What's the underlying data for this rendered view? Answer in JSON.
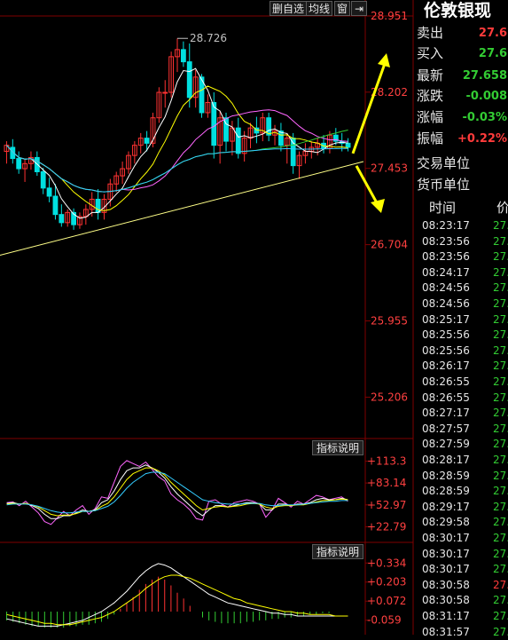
{
  "toolbar": {
    "del_fav": "删自选",
    "ma": "均线",
    "window": "窗"
  },
  "colors": {
    "up": "#ff3232",
    "down": "#00e0e0",
    "ma5": "#ffffff",
    "ma10": "#ffff00",
    "ma20": "#ff66ff",
    "ma60": "#33cc33",
    "ma120": "#33ccff",
    "trend": "#ffff88",
    "arrow": "#ffff00",
    "grid": "#800000",
    "axis_text": "#ff4040"
  },
  "instrument": {
    "title": "伦敦银现",
    "rows": [
      {
        "label": "卖出",
        "value": "27.6",
        "color": "#ff3b3b"
      },
      {
        "label": "买入",
        "value": "27.6",
        "color": "#33cc33"
      },
      {
        "label": "最新",
        "value": "27.658",
        "color": "#33cc33"
      },
      {
        "label": "涨跌",
        "value": "-0.008",
        "color": "#33cc33"
      },
      {
        "label": "涨幅",
        "value": "-0.03%",
        "color": "#33cc33"
      },
      {
        "label": "振幅",
        "value": "+0.22%",
        "color": "#ff3b3b"
      },
      {
        "label": "交易单位",
        "value": "",
        "color": "#e6e6e6"
      },
      {
        "label": "货币单位",
        "value": "",
        "color": "#e6e6e6"
      }
    ]
  },
  "ticks": {
    "header_time": "时间",
    "header_price": "价",
    "rows": [
      {
        "time": "08:23:17",
        "price": "27.",
        "dir": "down"
      },
      {
        "time": "08:23:56",
        "price": "27.",
        "dir": "down"
      },
      {
        "time": "08:23:56",
        "price": "27.",
        "dir": "down"
      },
      {
        "time": "08:24:17",
        "price": "27.",
        "dir": "down"
      },
      {
        "time": "08:24:56",
        "price": "27.",
        "dir": "down"
      },
      {
        "time": "08:24:56",
        "price": "27.",
        "dir": "down"
      },
      {
        "time": "08:25:17",
        "price": "27.",
        "dir": "down"
      },
      {
        "time": "08:25:56",
        "price": "27.",
        "dir": "down"
      },
      {
        "time": "08:25:56",
        "price": "27.",
        "dir": "down"
      },
      {
        "time": "08:26:17",
        "price": "27.",
        "dir": "down"
      },
      {
        "time": "08:26:55",
        "price": "27.",
        "dir": "down"
      },
      {
        "time": "08:26:55",
        "price": "27.",
        "dir": "down"
      },
      {
        "time": "08:27:17",
        "price": "27.",
        "dir": "down"
      },
      {
        "time": "08:27:57",
        "price": "27.",
        "dir": "down"
      },
      {
        "time": "08:27:59",
        "price": "27.",
        "dir": "down"
      },
      {
        "time": "08:28:17",
        "price": "27.",
        "dir": "down"
      },
      {
        "time": "08:28:59",
        "price": "27.",
        "dir": "down"
      },
      {
        "time": "08:28:59",
        "price": "27.",
        "dir": "down"
      },
      {
        "time": "08:29:17",
        "price": "27.",
        "dir": "down"
      },
      {
        "time": "08:29:58",
        "price": "27.",
        "dir": "down"
      },
      {
        "time": "08:30:17",
        "price": "27.",
        "dir": "down"
      },
      {
        "time": "08:30:17",
        "price": "27.",
        "dir": "down"
      },
      {
        "time": "08:30:17",
        "price": "27.",
        "dir": "down"
      },
      {
        "time": "08:30:58",
        "price": "27.",
        "dir": "up"
      },
      {
        "time": "08:30:58",
        "price": "27.",
        "dir": "down"
      },
      {
        "time": "08:31:17",
        "price": "27.",
        "dir": "down"
      },
      {
        "time": "08:31:57",
        "price": "27.",
        "dir": "down"
      }
    ]
  },
  "chart_data": [
    {
      "type": "candlestick",
      "ylim": [
        24.8,
        28.95
      ],
      "y_ticks": [
        28.951,
        28.202,
        27.453,
        26.704,
        25.955,
        25.206
      ],
      "y_tick_labels": [
        "28.951",
        "28.202",
        "27.453",
        "26.704",
        "25.955",
        "25.206"
      ],
      "annotation": "28.726",
      "candles": [
        [
          27.62,
          27.72,
          27.5,
          27.68
        ],
        [
          27.66,
          27.74,
          27.5,
          27.55
        ],
        [
          27.55,
          27.62,
          27.4,
          27.45
        ],
        [
          27.45,
          27.55,
          27.32,
          27.5
        ],
        [
          27.5,
          27.62,
          27.44,
          27.56
        ],
        [
          27.56,
          27.62,
          27.38,
          27.42
        ],
        [
          27.42,
          27.46,
          27.2,
          27.26
        ],
        [
          27.26,
          27.36,
          27.12,
          27.18
        ],
        [
          27.18,
          27.3,
          26.95,
          27.0
        ],
        [
          27.0,
          27.1,
          26.88,
          26.92
        ],
        [
          26.92,
          27.05,
          26.88,
          27.02
        ],
        [
          27.02,
          27.06,
          26.85,
          26.9
        ],
        [
          26.9,
          27.02,
          26.86,
          26.98
        ],
        [
          26.98,
          27.1,
          26.9,
          27.05
        ],
        [
          27.05,
          27.22,
          26.98,
          27.15
        ],
        [
          27.15,
          27.25,
          26.95,
          27.02
        ],
        [
          27.02,
          27.2,
          26.95,
          27.15
        ],
        [
          27.15,
          27.35,
          27.08,
          27.3
        ],
        [
          27.3,
          27.42,
          27.22,
          27.38
        ],
        [
          27.38,
          27.52,
          27.3,
          27.45
        ],
        [
          27.45,
          27.62,
          27.4,
          27.58
        ],
        [
          27.58,
          27.72,
          27.5,
          27.68
        ],
        [
          27.68,
          27.8,
          27.6,
          27.75
        ],
        [
          27.75,
          27.82,
          27.62,
          27.7
        ],
        [
          27.7,
          28.0,
          27.66,
          27.95
        ],
        [
          27.95,
          28.25,
          27.9,
          28.2
        ],
        [
          28.2,
          28.32,
          28.05,
          28.2
        ],
        [
          28.2,
          28.6,
          28.15,
          28.55
        ],
        [
          28.55,
          28.73,
          28.4,
          28.62
        ],
        [
          28.62,
          28.7,
          28.45,
          28.5
        ],
        [
          28.5,
          28.68,
          28.05,
          28.15
        ],
        [
          28.15,
          28.42,
          28.05,
          28.35
        ],
        [
          28.35,
          28.38,
          27.95,
          28.0
        ],
        [
          28.0,
          28.18,
          27.95,
          28.1
        ],
        [
          28.1,
          28.2,
          27.55,
          27.68
        ],
        [
          27.68,
          28.02,
          27.5,
          27.95
        ],
        [
          27.95,
          28.0,
          27.62,
          27.72
        ],
        [
          27.72,
          27.92,
          27.58,
          27.85
        ],
        [
          27.85,
          27.95,
          27.55,
          27.6
        ],
        [
          27.6,
          27.82,
          27.52,
          27.75
        ],
        [
          27.75,
          27.9,
          27.65,
          27.85
        ],
        [
          27.85,
          27.96,
          27.7,
          27.8
        ],
        [
          27.8,
          28.0,
          27.72,
          27.95
        ],
        [
          27.95,
          28.0,
          27.72,
          27.78
        ],
        [
          27.78,
          27.88,
          27.68,
          27.82
        ],
        [
          27.82,
          27.9,
          27.62,
          27.68
        ],
        [
          27.68,
          27.8,
          27.5,
          27.75
        ],
        [
          27.75,
          27.8,
          27.4,
          27.48
        ],
        [
          27.48,
          27.62,
          27.35,
          27.58
        ],
        [
          27.58,
          27.7,
          27.5,
          27.62
        ],
        [
          27.62,
          27.72,
          27.55,
          27.66
        ],
        [
          27.66,
          27.75,
          27.58,
          27.7
        ],
        [
          27.7,
          27.78,
          27.6,
          27.65
        ],
        [
          27.65,
          27.82,
          27.6,
          27.78
        ],
        [
          27.78,
          27.85,
          27.68,
          27.72
        ],
        [
          27.72,
          27.8,
          27.62,
          27.7
        ],
        [
          27.7,
          27.75,
          27.62,
          27.66
        ]
      ]
    },
    {
      "type": "line",
      "y_ticks": [
        113.3,
        83.14,
        52.97,
        22.79
      ],
      "y_tick_labels": [
        "+113.3",
        "+83.14",
        "+52.97",
        "+22.79"
      ],
      "ylim": [
        5,
        120
      ],
      "series": [
        {
          "color": "#ff66ff",
          "values": [
            56,
            57,
            52,
            58,
            50,
            42,
            30,
            26,
            35,
            44,
            38,
            46,
            52,
            40,
            48,
            64,
            62,
            84,
            106,
            114,
            110,
            106,
            112,
            102,
            92,
            86,
            68,
            60,
            54,
            46,
            34,
            32,
            58,
            60,
            54,
            50,
            56,
            58,
            60,
            58,
            54,
            36,
            46,
            62,
            56,
            50,
            58,
            54,
            60,
            66,
            64,
            60,
            62,
            64,
            58
          ]
        },
        {
          "color": "#ffffff",
          "values": [
            55,
            56,
            54,
            55,
            52,
            48,
            40,
            34,
            34,
            38,
            38,
            42,
            46,
            44,
            46,
            56,
            60,
            72,
            88,
            100,
            104,
            104,
            108,
            104,
            98,
            90,
            78,
            68,
            60,
            52,
            44,
            38,
            46,
            52,
            52,
            50,
            52,
            54,
            56,
            56,
            54,
            46,
            46,
            54,
            54,
            52,
            54,
            54,
            56,
            60,
            62,
            60,
            60,
            62,
            60
          ]
        },
        {
          "color": "#ffff00",
          "values": [
            54,
            55,
            54,
            55,
            53,
            50,
            45,
            40,
            38,
            39,
            39,
            41,
            44,
            44,
            45,
            51,
            55,
            64,
            76,
            88,
            96,
            100,
            104,
            104,
            100,
            94,
            84,
            76,
            68,
            60,
            52,
            46,
            48,
            50,
            51,
            50,
            51,
            52,
            54,
            55,
            54,
            50,
            48,
            51,
            52,
            52,
            53,
            53,
            55,
            57,
            59,
            59,
            60,
            61,
            60
          ]
        },
        {
          "color": "#33ccff",
          "values": [
            53,
            54,
            54,
            54,
            53,
            51,
            48,
            45,
            43,
            42,
            42,
            43,
            44,
            44,
            45,
            48,
            51,
            57,
            66,
            76,
            84,
            90,
            96,
            98,
            98,
            96,
            90,
            84,
            78,
            72,
            66,
            60,
            58,
            56,
            55,
            54,
            54,
            54,
            55,
            55,
            55,
            53,
            52,
            52,
            53,
            53,
            53,
            54,
            55,
            56,
            57,
            58,
            58,
            59,
            59
          ]
        }
      ]
    },
    {
      "type": "bar",
      "name": "macd",
      "y_ticks": [
        0.334,
        0.203,
        0.072,
        -0.059
      ],
      "y_tick_labels": [
        "+0.334",
        "+0.203",
        "+0.072",
        "-0.059"
      ],
      "ylim": [
        -0.14,
        0.36
      ],
      "values": [
        -0.06,
        -0.07,
        -0.08,
        -0.09,
        -0.1,
        -0.1,
        -0.11,
        -0.11,
        -0.11,
        -0.11,
        -0.1,
        -0.1,
        -0.09,
        -0.09,
        -0.08,
        -0.07,
        -0.05,
        -0.02,
        0.02,
        0.06,
        0.1,
        0.15,
        0.19,
        0.22,
        0.24,
        0.22,
        0.18,
        0.13,
        0.09,
        0.04,
        0.0,
        -0.04,
        -0.06,
        -0.07,
        -0.08,
        -0.08,
        -0.08,
        -0.08,
        -0.07,
        -0.07,
        -0.06,
        -0.06,
        -0.05,
        -0.05,
        -0.04,
        -0.04,
        -0.03,
        -0.03,
        -0.02,
        -0.02,
        -0.01,
        -0.01,
        0.0,
        0.0,
        0.0
      ],
      "series": [
        {
          "color": "#ffffff",
          "values": [
            -0.05,
            -0.06,
            -0.07,
            -0.08,
            -0.09,
            -0.1,
            -0.1,
            -0.1,
            -0.1,
            -0.09,
            -0.08,
            -0.07,
            -0.06,
            -0.04,
            -0.02,
            0.0,
            0.03,
            0.06,
            0.1,
            0.14,
            0.19,
            0.24,
            0.28,
            0.31,
            0.33,
            0.32,
            0.3,
            0.27,
            0.24,
            0.21,
            0.18,
            0.15,
            0.12,
            0.1,
            0.08,
            0.06,
            0.05,
            0.04,
            0.03,
            0.02,
            0.01,
            0.0,
            -0.01,
            -0.01,
            -0.02,
            -0.02,
            -0.03,
            -0.03,
            -0.03,
            -0.03,
            -0.03,
            -0.03,
            -0.03,
            -0.03,
            -0.03
          ]
        },
        {
          "color": "#ffff00",
          "values": [
            -0.02,
            -0.03,
            -0.04,
            -0.05,
            -0.06,
            -0.07,
            -0.08,
            -0.08,
            -0.09,
            -0.09,
            -0.09,
            -0.08,
            -0.07,
            -0.06,
            -0.05,
            -0.04,
            -0.02,
            0.0,
            0.03,
            0.06,
            0.09,
            0.12,
            0.16,
            0.19,
            0.22,
            0.24,
            0.25,
            0.25,
            0.24,
            0.23,
            0.21,
            0.19,
            0.17,
            0.15,
            0.13,
            0.11,
            0.09,
            0.08,
            0.06,
            0.05,
            0.04,
            0.03,
            0.02,
            0.01,
            0.0,
            0.0,
            -0.01,
            -0.01,
            -0.02,
            -0.02,
            -0.02,
            -0.02,
            -0.03,
            -0.03,
            -0.03
          ]
        }
      ]
    }
  ],
  "indicator_tag": "指标说明"
}
